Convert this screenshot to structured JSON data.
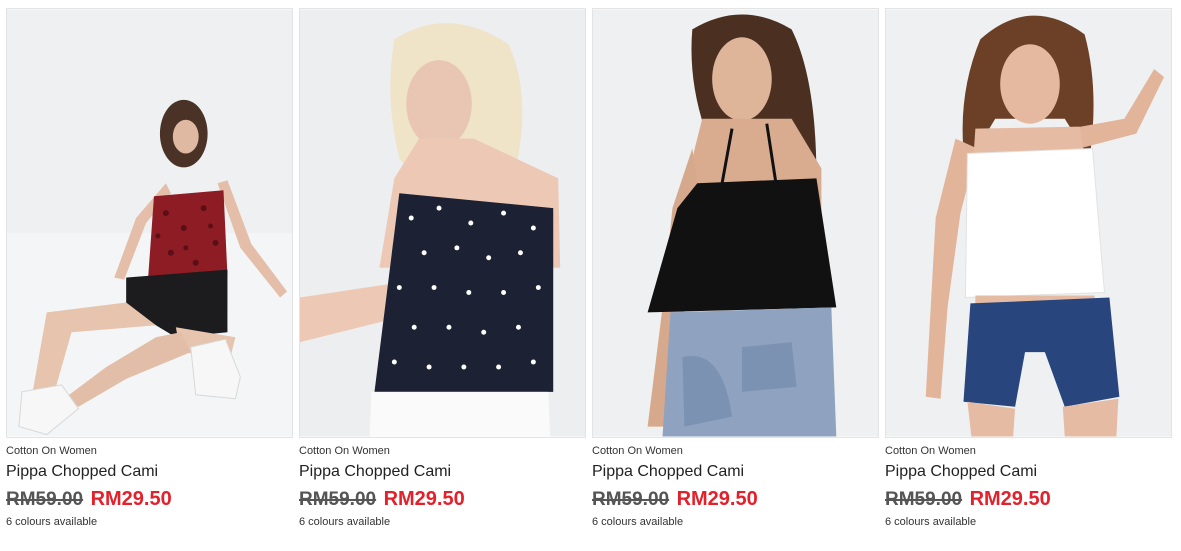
{
  "products": [
    {
      "brand": "Cotton On Women",
      "name": "Pippa Chopped Cami",
      "old_price": "RM59.00",
      "sale_price": "RM29.50",
      "colours": "6 colours available",
      "image": "model-red-print-cami",
      "bg_color": "#eef0f1",
      "top_color": "#8e1c24"
    },
    {
      "brand": "Cotton On Women",
      "name": "Pippa Chopped Cami",
      "old_price": "RM59.00",
      "sale_price": "RM29.50",
      "colours": "6 colours available",
      "image": "model-navy-polka-dot-cami",
      "bg_color": "#eceef0",
      "top_color": "#1c2134"
    },
    {
      "brand": "Cotton On Women",
      "name": "Pippa Chopped Cami",
      "old_price": "RM59.00",
      "sale_price": "RM29.50",
      "colours": "6 colours available",
      "image": "model-black-cami",
      "bg_color": "#eef0f1",
      "top_color": "#111111"
    },
    {
      "brand": "Cotton On Women",
      "name": "Pippa Chopped Cami",
      "old_price": "RM59.00",
      "sale_price": "RM29.50",
      "colours": "6 colours available",
      "image": "model-white-cami",
      "bg_color": "#eef0f2",
      "top_color": "#ffffff"
    }
  ],
  "colors": {
    "sale_price": "#e4202a",
    "old_price": "#555555"
  }
}
